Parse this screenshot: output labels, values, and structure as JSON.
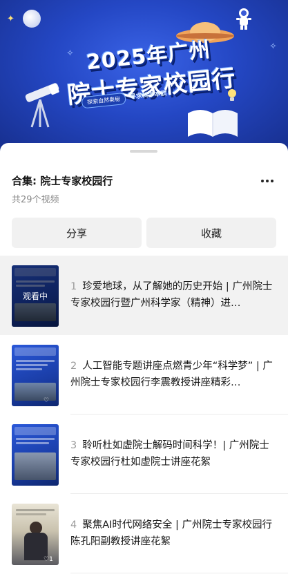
{
  "banner": {
    "title_line1": "2025年广州",
    "title_line2": "院士专家校园行",
    "pill1": "探索自然奥秘",
    "pill2": "寻求科学本质"
  },
  "sheet": {
    "collection_title": "合集: 院士专家校园行",
    "video_count": "共29个视频",
    "share_label": "分享",
    "favorite_label": "收藏"
  },
  "videos": [
    {
      "num": "1",
      "title": "珍爱地球，从了解她的历史开始 | 广州院士专家校园行暨广州科学家（精神）进…",
      "overlay": "观看中"
    },
    {
      "num": "2",
      "title": "人工智能专题讲座点燃青少年“科学梦” | 广州院士专家校园行李震教授讲座精彩…",
      "like": "♡"
    },
    {
      "num": "3",
      "title": "聆听杜如虚院士解码时间科学！| 广州院士专家校园行杜如虚院士讲座花絮"
    },
    {
      "num": "4",
      "title": "聚焦AI时代网络安全 | 广州院士专家校园行陈孔阳副教授讲座花絮",
      "like": "♡1"
    }
  ],
  "colors": {
    "banner": "#2447c4",
    "button_bg": "#f1f1f1",
    "active_row": "#f2f2f2"
  }
}
